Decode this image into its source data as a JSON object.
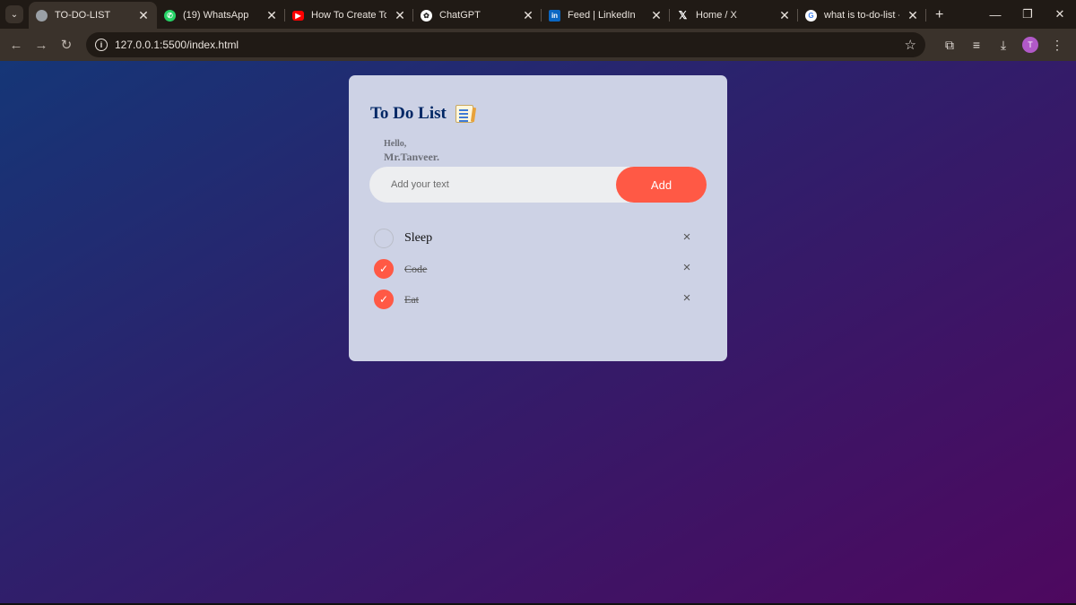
{
  "browser": {
    "tabs": [
      {
        "title": "TO-DO-LIST",
        "icon": "globe-icon",
        "active": true
      },
      {
        "title": "(19) WhatsApp",
        "icon": "whatsapp-icon",
        "active": false
      },
      {
        "title": "How To Create To-Do",
        "icon": "youtube-icon",
        "active": false
      },
      {
        "title": "ChatGPT",
        "icon": "chatgpt-icon",
        "active": false
      },
      {
        "title": "Feed | LinkedIn",
        "icon": "linkedin-icon",
        "active": false
      },
      {
        "title": "Home / X",
        "icon": "x-icon",
        "active": false
      },
      {
        "title": "what is to-do-list - Go",
        "icon": "google-icon",
        "active": false
      }
    ],
    "url": "127.0.0.1:5500/index.html",
    "profile_initial": "T",
    "profile_color": "#b159c8"
  },
  "app": {
    "title": "To Do List",
    "greeting_hello": "Hello,",
    "greeting_name": "Mr.Tanveer.",
    "input_placeholder": "Add your text",
    "input_value": "",
    "add_label": "Add",
    "accent_color": "#ff5945",
    "tasks": [
      {
        "text": "Sleep",
        "done": false
      },
      {
        "text": "Code",
        "done": true
      },
      {
        "text": "Eat",
        "done": true
      }
    ]
  }
}
